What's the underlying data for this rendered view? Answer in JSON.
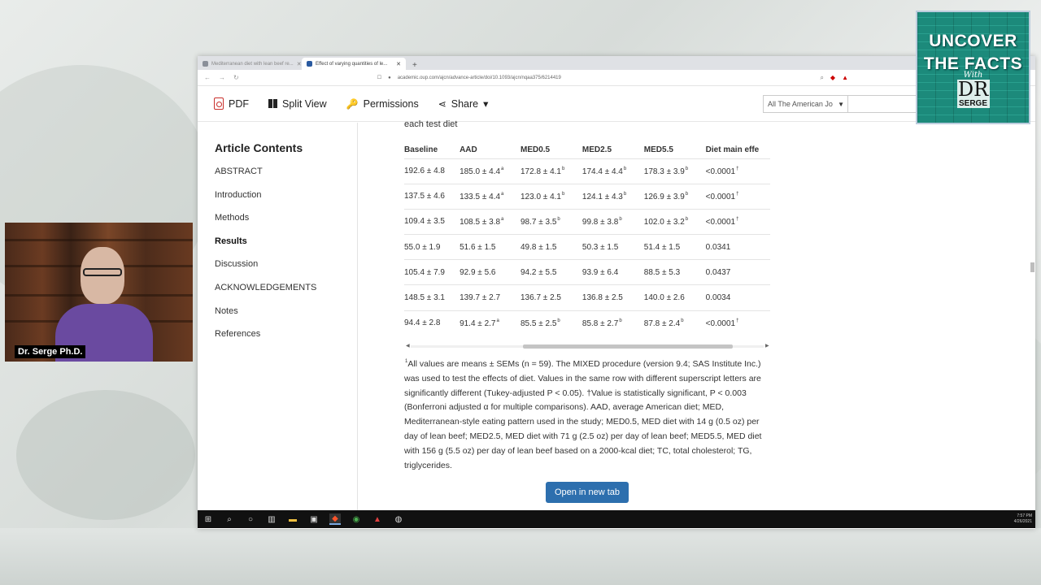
{
  "browser": {
    "tabs": [
      {
        "label": "Mediterranean diet with lean beef re...",
        "active": false
      },
      {
        "label": "Effect of varying quantities of le...",
        "active": true
      }
    ],
    "url": "academic.oup.com/ajcn/advance-article/doi/10.1093/ajcn/nqaa375/6214419"
  },
  "toolbar": {
    "pdf_label": "PDF",
    "split_view_label": "Split View",
    "permissions_label": "Permissions",
    "share_label": "Share",
    "share_chevron": "▾",
    "journal_select": "All The American Jo"
  },
  "sidebar": {
    "title": "Article Contents",
    "items": [
      {
        "label": "ABSTRACT"
      },
      {
        "label": "Introduction"
      },
      {
        "label": "Methods"
      },
      {
        "label": "Results",
        "active": true
      },
      {
        "label": "Discussion"
      },
      {
        "label": "ACKNOWLEDGEMENTS"
      },
      {
        "label": "Notes"
      },
      {
        "label": "References"
      }
    ]
  },
  "main": {
    "caption_fragment": "each test diet",
    "table": {
      "headers": [
        "Baseline",
        "AAD",
        "MED0.5",
        "MED2.5",
        "MED5.5",
        "Diet main effe"
      ],
      "rows": [
        [
          {
            "v": "192.6 ± 4.8"
          },
          {
            "v": "185.0 ± 4.4",
            "s": "a"
          },
          {
            "v": "172.8 ± 4.1",
            "s": "b"
          },
          {
            "v": "174.4 ± 4.4",
            "s": "b"
          },
          {
            "v": "178.3 ± 3.9",
            "s": "b"
          },
          {
            "v": "<0.0001",
            "s": "†"
          }
        ],
        [
          {
            "v": "137.5 ± 4.6"
          },
          {
            "v": "133.5 ± 4.4",
            "s": "a"
          },
          {
            "v": "123.0 ± 4.1",
            "s": "b"
          },
          {
            "v": "124.1 ± 4.3",
            "s": "b"
          },
          {
            "v": "126.9 ± 3.9",
            "s": "b"
          },
          {
            "v": "<0.0001",
            "s": "†"
          }
        ],
        [
          {
            "v": "109.4 ± 3.5"
          },
          {
            "v": "108.5 ± 3.8",
            "s": "a"
          },
          {
            "v": "98.7 ± 3.5",
            "s": "b"
          },
          {
            "v": "99.8 ± 3.8",
            "s": "b"
          },
          {
            "v": "102.0 ± 3.2",
            "s": "b"
          },
          {
            "v": "<0.0001",
            "s": "†"
          }
        ],
        [
          {
            "v": "55.0 ± 1.9"
          },
          {
            "v": "51.6 ± 1.5"
          },
          {
            "v": "49.8 ± 1.5"
          },
          {
            "v": "50.3 ± 1.5"
          },
          {
            "v": "51.4 ± 1.5"
          },
          {
            "v": "0.0341"
          }
        ],
        [
          {
            "v": "105.4 ± 7.9"
          },
          {
            "v": "92.9 ± 5.6"
          },
          {
            "v": "94.2 ± 5.5"
          },
          {
            "v": "93.9 ± 6.4"
          },
          {
            "v": "88.5 ± 5.3"
          },
          {
            "v": "0.0437"
          }
        ],
        [
          {
            "v": "148.5 ± 3.1"
          },
          {
            "v": "139.7 ± 2.7"
          },
          {
            "v": "136.7 ± 2.5"
          },
          {
            "v": "136.8 ± 2.5"
          },
          {
            "v": "140.0 ± 2.6"
          },
          {
            "v": "0.0034"
          }
        ],
        [
          {
            "v": "94.4 ± 2.8"
          },
          {
            "v": "91.4 ± 2.7",
            "s": "a"
          },
          {
            "v": "85.5 ± 2.5",
            "s": "b"
          },
          {
            "v": "85.8 ± 2.7",
            "s": "b"
          },
          {
            "v": "87.8 ± 2.4",
            "s": "b"
          },
          {
            "v": "<0.0001",
            "s": "†"
          }
        ]
      ]
    },
    "footnote": "All values are means ± SEMs (n = 59). The MIXED procedure (version 9.4; SAS Institute Inc.) was used to test the effects of diet. Values in the same row with different superscript letters are significantly different (Tukey-adjusted P < 0.05). †Value is statistically significant, P < 0.003 (Bonferroni adjusted α for multiple comparisons). AAD, average American diet; MED, Mediterranean-style eating pattern used in the study; MED0.5, MED diet with 14 g (0.5 oz) per day of lean beef; MED2.5, MED diet with 71 g (2.5 oz) per day of lean beef; MED5.5, MED diet with 156 g (5.5 oz) per day of lean beef based on a 2000-kcal diet; TC, total cholesterol; TG, triglycerides.",
    "footnote_marker": "1",
    "open_button": "Open in new tab"
  },
  "taskbar": {
    "time": "7:57 PM",
    "date": "4/26/2021"
  },
  "overlay": {
    "presenter_name": "Dr. Serge Ph.D.",
    "logo_line1": "UNCOVER",
    "logo_line2": "THE FACTS",
    "logo_with": "With",
    "logo_dr": "DR",
    "logo_serge": "SERGE"
  },
  "colors": {
    "accent_button": "#2d6fae",
    "pdf_icon": "#c9302c",
    "logo_bg": "#1c8a7b"
  }
}
